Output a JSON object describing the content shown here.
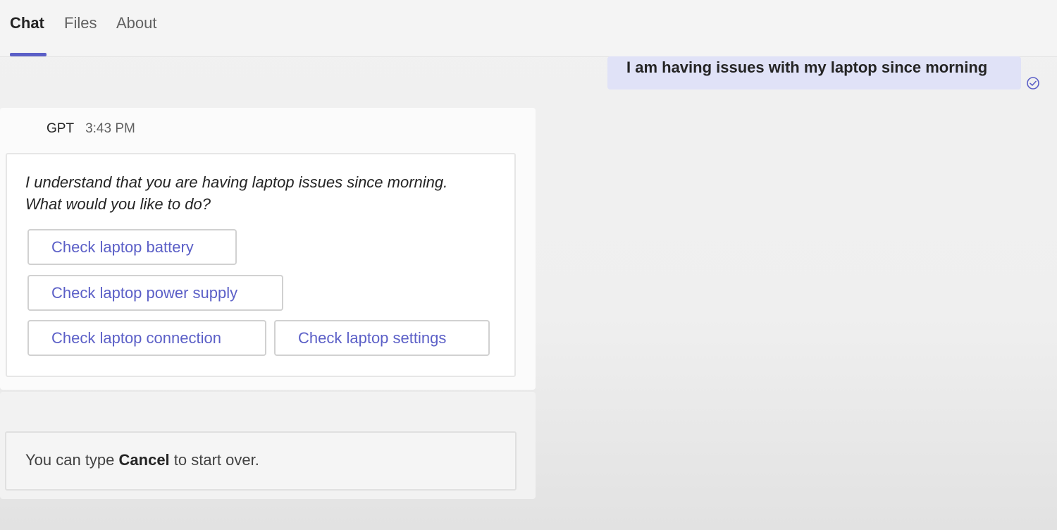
{
  "tabs": [
    {
      "label": "Chat",
      "active": true
    },
    {
      "label": "Files",
      "active": false
    },
    {
      "label": "About",
      "active": false
    }
  ],
  "user_message": {
    "text": "I am having issues with my laptop since morning",
    "status_icon": "sent-check-icon"
  },
  "bot_message": {
    "sender": "GPT",
    "time": "3:43 PM",
    "text_line1": "I understand that you are having laptop issues since morning.",
    "text_line2": "What would you like to do?",
    "choices": [
      "Check laptop battery",
      "Check laptop power supply",
      "Check laptop connection",
      "Check laptop settings"
    ]
  },
  "cancel_hint": {
    "prefix": "You can type ",
    "keyword": "Cancel",
    "suffix": " to start over."
  },
  "colors": {
    "accent": "#5b5fc7",
    "user_bubble": "#e0e2f7"
  }
}
